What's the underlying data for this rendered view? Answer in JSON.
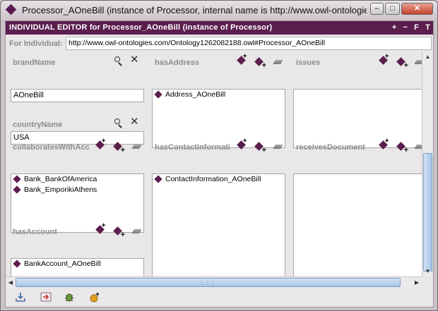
{
  "window": {
    "title": "Processor_AOneBill   (instance of Processor, internal name is http://www.owl-ontologies.c...",
    "controls": [
      "minimize",
      "maximize",
      "close"
    ]
  },
  "header": {
    "title": "INDIVIDUAL EDITOR for Processor_AOneBill  (instance of Processor)",
    "tools": [
      "+",
      "−",
      "F",
      "T"
    ]
  },
  "for_individual": {
    "label": "For Individual:",
    "value": "http://www.owl-ontologies.com/Ontology1262082188.owl#Processor_AOneBill"
  },
  "properties": {
    "brandName": {
      "label": "brandName",
      "value": "AOneBill"
    },
    "countryName": {
      "label": "countryName",
      "value": "USA"
    },
    "hasAddress": {
      "label": "hasAddress",
      "items": [
        "Address_AOneBill"
      ]
    },
    "issues": {
      "label": "issues",
      "items": []
    },
    "collaboratesWith": {
      "label": "collaboratesWithAcc",
      "items": [
        "Bank_BankOfAmerica",
        "Bank_EmporikiAthens"
      ]
    },
    "hasContactInformation": {
      "label": "hasContactInformati",
      "items": [
        "ContactInformation_AOneBill"
      ]
    },
    "receivesDocument": {
      "label": "receivesDocument",
      "items": []
    },
    "hasAccount": {
      "label": "hasAccount",
      "items": [
        "BankAccount_AOneBill"
      ]
    }
  },
  "colors": {
    "header_bg": "#5b1e4d",
    "instance_icon": "#5b1e4d",
    "label_gray": "#8d8d8d"
  },
  "bottom_toolbar": [
    "import-icon",
    "export-icon",
    "bug-icon",
    "create-instance-icon"
  ]
}
